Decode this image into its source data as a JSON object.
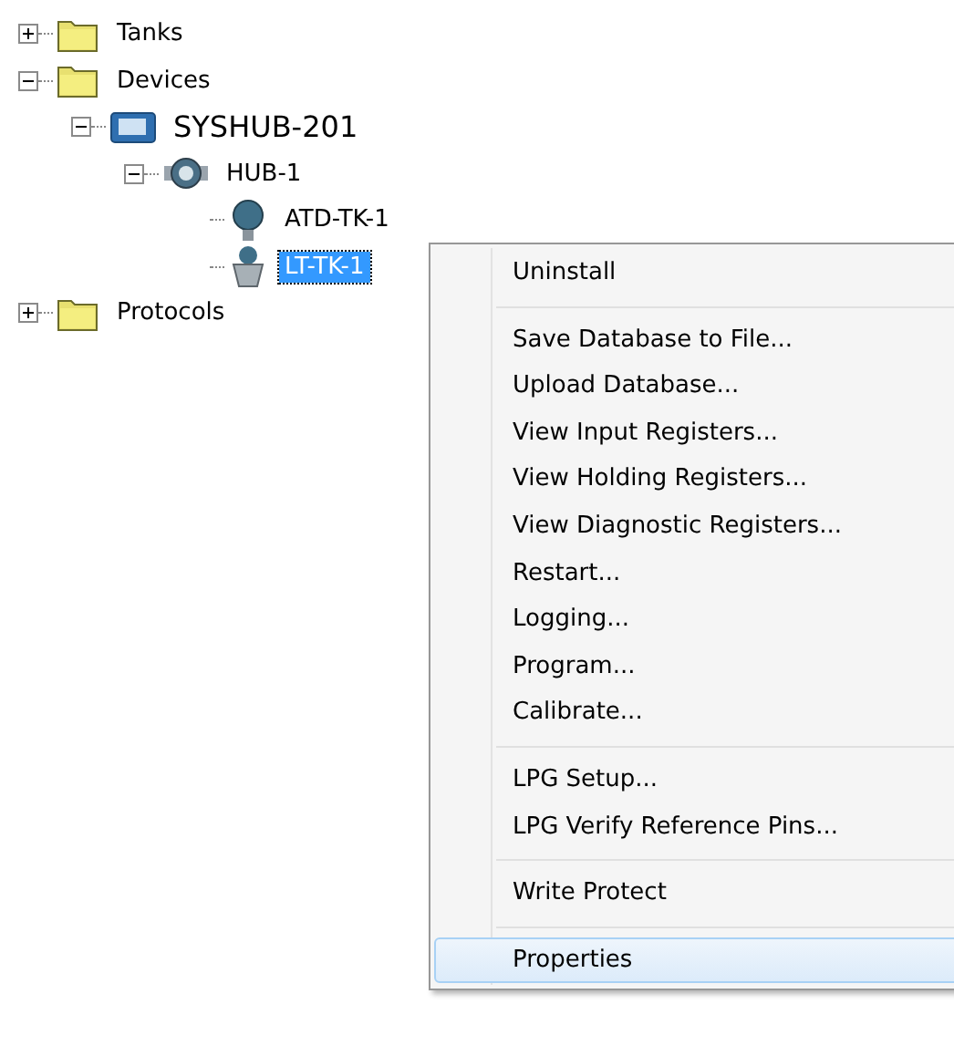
{
  "tree": [
    {
      "label": "Tanks",
      "kind": "folder",
      "expanded": false,
      "selected": false
    },
    {
      "label": "Devices",
      "kind": "folder",
      "expanded": true,
      "selected": false,
      "children": [
        {
          "label": "SYSHUB-201",
          "kind": "gateway",
          "expanded": true,
          "selected": false,
          "children": [
            {
              "label": "HUB-1",
              "kind": "hub",
              "expanded": true,
              "selected": false,
              "children": [
                {
                  "label": "ATD-TK-1",
                  "kind": "sensor",
                  "selected": false
                },
                {
                  "label": "LT-TK-1",
                  "kind": "transmitter",
                  "selected": true
                }
              ]
            }
          ]
        }
      ]
    },
    {
      "label": "Protocols",
      "kind": "folder",
      "expanded": false,
      "selected": false
    }
  ],
  "context_menu": {
    "groups": [
      [
        {
          "label": "Uninstall",
          "selected": false
        }
      ],
      [
        {
          "label": "Save Database to File...",
          "selected": false
        },
        {
          "label": "Upload Database...",
          "selected": false
        },
        {
          "label": "View Input Registers...",
          "selected": false
        },
        {
          "label": "View Holding Registers...",
          "selected": false
        },
        {
          "label": "View Diagnostic Registers...",
          "selected": false
        },
        {
          "label": "Restart...",
          "selected": false
        },
        {
          "label": "Logging...",
          "selected": false
        },
        {
          "label": "Program...",
          "selected": false
        },
        {
          "label": "Calibrate...",
          "selected": false
        }
      ],
      [
        {
          "label": "LPG Setup...",
          "selected": false
        },
        {
          "label": "LPG Verify Reference Pins...",
          "selected": false
        }
      ],
      [
        {
          "label": "Write Protect",
          "selected": false
        }
      ],
      [
        {
          "label": "Properties",
          "selected": true
        }
      ]
    ]
  }
}
